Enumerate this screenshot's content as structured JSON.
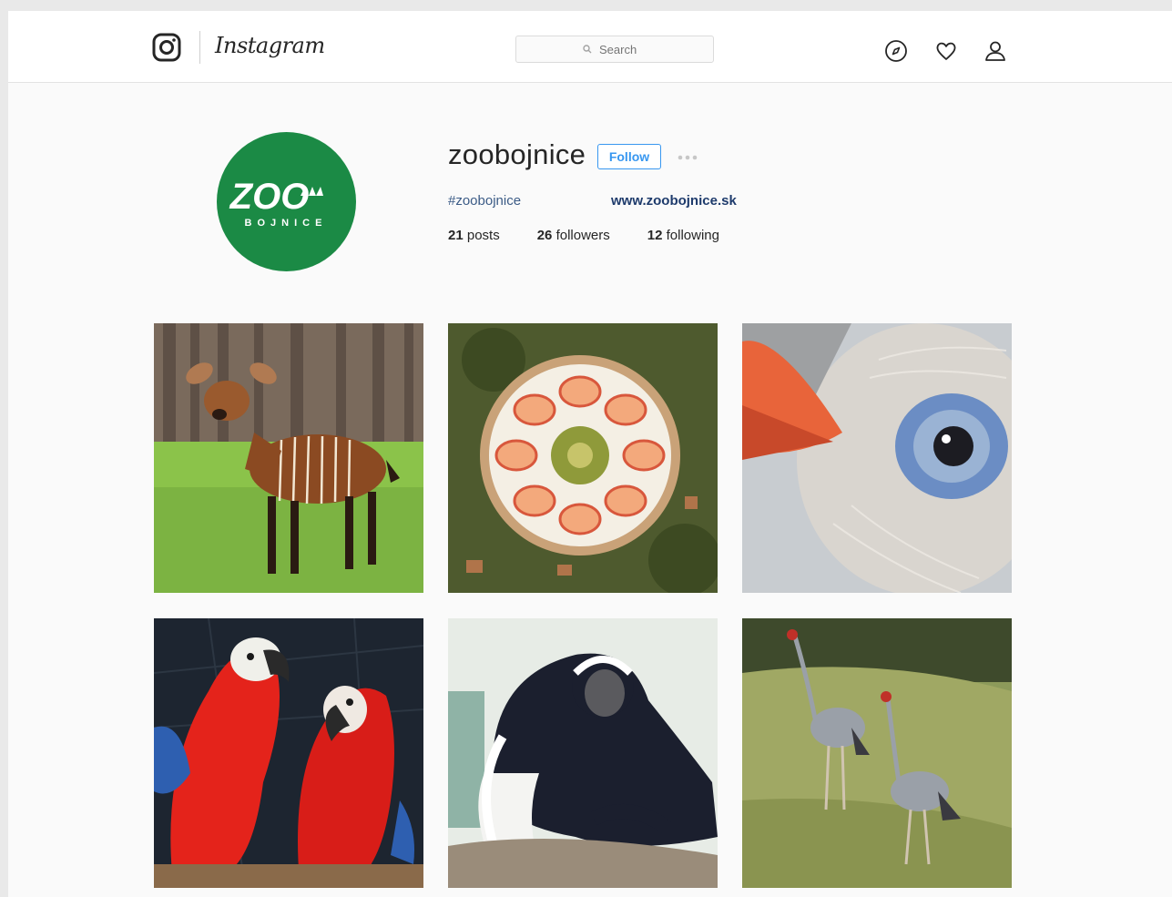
{
  "app": {
    "wordmark": "Instagram"
  },
  "search": {
    "placeholder": "Search"
  },
  "nav": {
    "icons": [
      "compass-icon",
      "heart-icon",
      "person-icon"
    ]
  },
  "profile": {
    "username": "zoobojnice",
    "follow_label": "Follow",
    "hashtag": "#zoobojnice",
    "website": "www.zoobojnice.sk",
    "logo_text": "ZOO",
    "logo_subtext": "BOJNICE",
    "stats": [
      {
        "count": "21",
        "label": "posts"
      },
      {
        "count": "26",
        "label": "followers"
      },
      {
        "count": "12",
        "label": "following"
      }
    ]
  },
  "posts": [
    {
      "subject": "antelope-calf"
    },
    {
      "subject": "fruit-cake"
    },
    {
      "subject": "bird-eye-closeup"
    },
    {
      "subject": "macaws"
    },
    {
      "subject": "colobus-monkey"
    },
    {
      "subject": "cranes"
    }
  ],
  "colors": {
    "brand_green": "#1b8a45",
    "follow_blue": "#3897f0",
    "link_blue": "#1e3b6c"
  }
}
